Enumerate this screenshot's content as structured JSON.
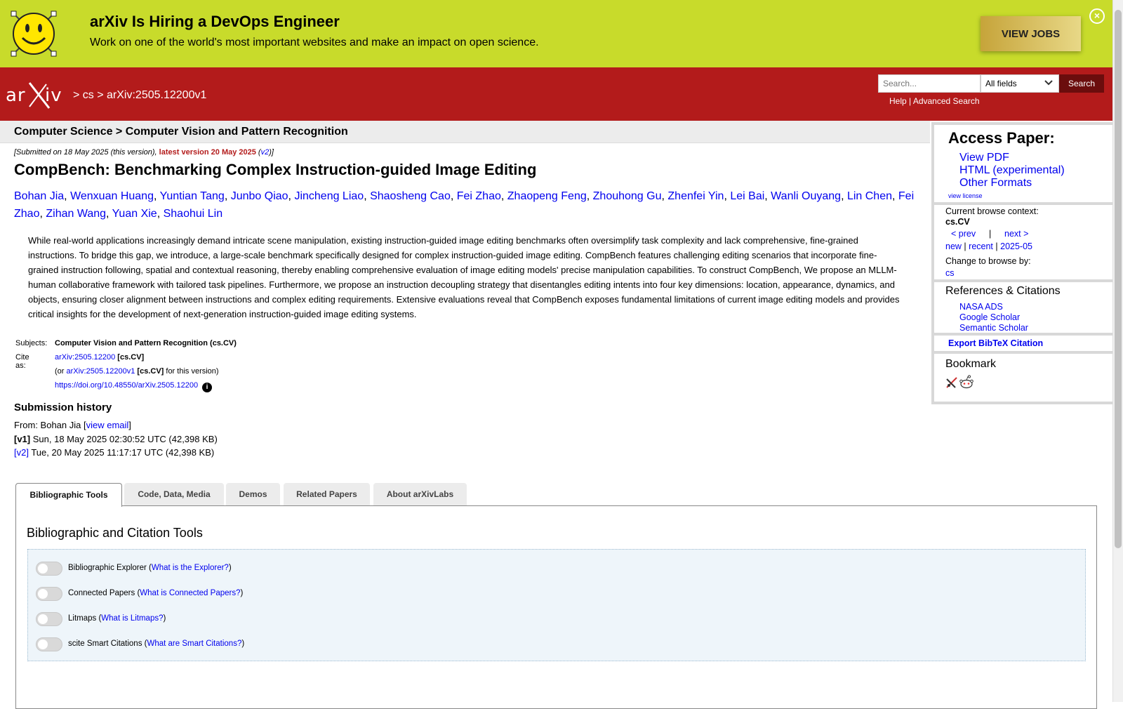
{
  "banner": {
    "title": "arXiv Is Hiring a DevOps Engineer",
    "text": "Work on one of the world's most important websites and make an impact on open science.",
    "button": "VIEW JOBS",
    "close": "×"
  },
  "header": {
    "logo_alt": "arXiv",
    "crumb_1": "> cs >",
    "crumb_2": "arXiv:2505.12200v1",
    "search_placeholder": "Search...",
    "search_field": "All fields",
    "search_button": "Search",
    "help": "Help",
    "help_sep": "|",
    "advanced": "Advanced Search"
  },
  "subheader": "Computer Science > Computer Vision and Pattern Recognition",
  "dateline": {
    "prefix": "[Submitted on 18 May 2025 (this version), ",
    "latest": "latest version 20 May 2025",
    "open_paren": " (",
    "v2": "v2",
    "close": ")]"
  },
  "title": "CompBench: Benchmarking Complex Instruction-guided Image Editing",
  "authors": [
    "Bohan Jia",
    "Wenxuan Huang",
    "Yuntian Tang",
    "Junbo Qiao",
    "Jincheng Liao",
    "Shaosheng Cao",
    "Fei Zhao",
    "Zhaopeng Feng",
    "Zhouhong Gu",
    "Zhenfei Yin",
    "Lei Bai",
    "Wanli Ouyang",
    "Lin Chen",
    "Fei Zhao",
    "Zihan Wang",
    "Yuan Xie",
    "Shaohui Lin"
  ],
  "abstract": "While real-world applications increasingly demand intricate scene manipulation, existing instruction-guided image editing benchmarks often oversimplify task complexity and lack comprehensive, fine-grained instructions. To bridge this gap, we introduce, a large-scale benchmark specifically designed for complex instruction-guided image editing. CompBench features challenging editing scenarios that incorporate fine-grained instruction following, spatial and contextual reasoning, thereby enabling comprehensive evaluation of image editing models' precise manipulation capabilities. To construct CompBench, We propose an MLLM-human collaborative framework with tailored task pipelines. Furthermore, we propose an instruction decoupling strategy that disentangles editing intents into four key dimensions: location, appearance, dynamics, and objects, ensuring closer alignment between instructions and complex editing requirements. Extensive evaluations reveal that CompBench exposes fundamental limitations of current image editing models and provides critical insights for the development of next-generation instruction-guided image editing systems.",
  "meta": {
    "subjects_label": "Subjects:",
    "subjects_value": "Computer Vision and Pattern Recognition (cs.CV)",
    "cite_label": "Cite as:",
    "cite_link": "arXiv:2505.12200",
    "cite_tag": "[cs.CV]",
    "or_prefix": "(or ",
    "or_link": "arXiv:2505.12200v1",
    "or_tag": "[cs.CV]",
    "or_suffix": " for this version)",
    "doi": "https://doi.org/10.48550/arXiv.2505.12200",
    "info": "i"
  },
  "submission": {
    "title": "Submission history",
    "from_prefix": "From: Bohan Jia [",
    "view_email": "view email",
    "from_suffix": "]",
    "v1_label": "[v1]",
    "v1_text": " Sun, 18 May 2025 02:30:52 UTC (42,398 KB)",
    "v2_label": "[v2]",
    "v2_text": " Tue, 20 May 2025 11:17:17 UTC (42,398 KB)"
  },
  "tabs": [
    "Bibliographic Tools",
    "Code, Data, Media",
    "Demos",
    "Related Papers",
    "About arXivLabs"
  ],
  "panel": {
    "title": "Bibliographic and Citation Tools",
    "tools": [
      {
        "label": "Bibliographic Explorer (",
        "link": "What is the Explorer?",
        "end": ")",
        "enabled": false
      },
      {
        "label": "Connected Papers (",
        "link": "What is Connected Papers?",
        "end": ")",
        "enabled": false
      },
      {
        "label": "Litmaps (",
        "link": "What is Litmaps?",
        "end": ")",
        "enabled": false
      },
      {
        "label": "scite Smart Citations (",
        "link": "What are Smart Citations?",
        "end": ")",
        "enabled": false
      }
    ]
  },
  "sidebar": {
    "access_title": "Access Paper:",
    "view_pdf": "View PDF",
    "html": "HTML (experimental)",
    "other_formats": "Other Formats",
    "view_license": "view license",
    "browse_context": "Current browse context:",
    "context_value": "cs.CV",
    "prev": "< prev",
    "pipe": "|",
    "next": "next >",
    "new": "new",
    "recent": "recent",
    "month": "2025-05",
    "change_browse": "Change to browse by:",
    "cs": "cs",
    "refs_title": "References & Citations",
    "nasa": "NASA ADS",
    "google": "Google Scholar",
    "semantic": "Semantic Scholar",
    "export": "Export BibTeX Citation",
    "bookmark": "Bookmark"
  },
  "colors": {
    "banner": "#c8db2b",
    "header": "#b31b1b",
    "search_button": "#6b0d0d",
    "link": "#0000ee"
  }
}
